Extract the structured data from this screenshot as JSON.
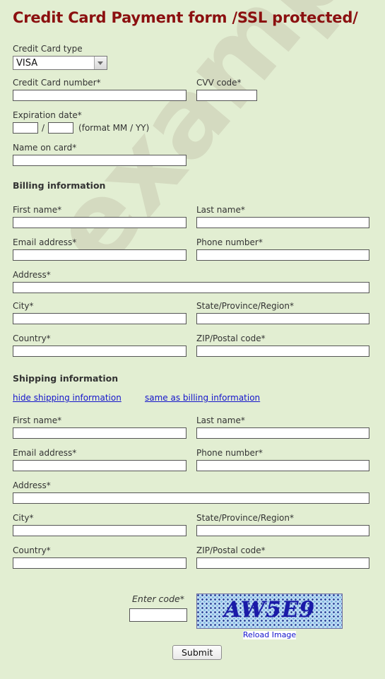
{
  "page": {
    "title": "Credit Card Payment form /SSL protected/",
    "background_color": "#e2eed2",
    "title_color": "#8b1010",
    "watermark_text": "example"
  },
  "card": {
    "type_label": "Credit Card type",
    "type_value": "VISA",
    "type_options": [
      "VISA"
    ],
    "number_label": "Credit Card number*",
    "number_value": "",
    "cvv_label": "CVV code*",
    "cvv_value": "",
    "expiration_label": "Expiration date*",
    "expiration_month_value": "",
    "expiration_year_value": "",
    "expiration_separator": "/",
    "expiration_format_hint": "(format MM / YY)",
    "name_label": "Name on card*",
    "name_value": ""
  },
  "billing": {
    "heading": "Billing information",
    "first_name_label": "First name*",
    "first_name_value": "",
    "last_name_label": "Last name*",
    "last_name_value": "",
    "email_label": "Email address*",
    "email_value": "",
    "phone_label": "Phone number*",
    "phone_value": "",
    "address_label": "Address*",
    "address_value": "",
    "city_label": "City*",
    "city_value": "",
    "state_label": "State/Province/Region*",
    "state_value": "",
    "country_label": "Country*",
    "country_value": "",
    "zip_label": "ZIP/Postal code*",
    "zip_value": ""
  },
  "shipping": {
    "heading": "Shipping information",
    "hide_link": "hide shipping information",
    "same_as_billing_link": "same as billing information",
    "first_name_label": "First name*",
    "first_name_value": "",
    "last_name_label": "Last name*",
    "last_name_value": "",
    "email_label": "Email address*",
    "email_value": "",
    "phone_label": "Phone number*",
    "phone_value": "",
    "address_label": "Address*",
    "address_value": "",
    "city_label": "City*",
    "city_value": "",
    "state_label": "State/Province/Region*",
    "state_value": "",
    "country_label": "Country*",
    "country_value": "",
    "zip_label": "ZIP/Postal code*",
    "zip_value": ""
  },
  "captcha": {
    "enter_code_label": "Enter code*",
    "enter_code_value": "",
    "image_text": "AW5E9",
    "reload_link": "Reload Image",
    "image_bg_color": "#bcdcf4",
    "image_text_color": "#1a1aa8"
  },
  "actions": {
    "submit_label": "Submit"
  }
}
